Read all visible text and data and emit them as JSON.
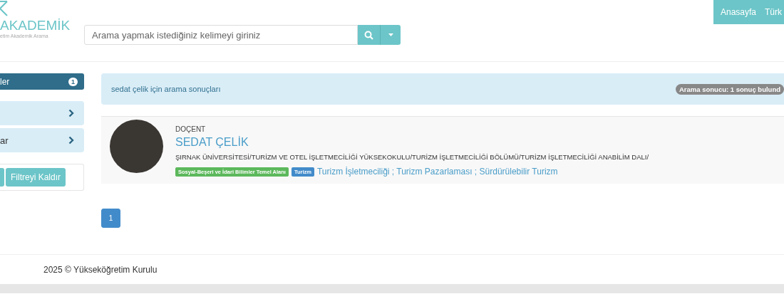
{
  "header": {
    "logo": {
      "title": "AKADEMİK",
      "subtitle": "etim Akademik Arama"
    },
    "search": {
      "placeholder": "Arama yapmak istediğiniz kelimeyi giriniz"
    },
    "nav": [
      {
        "label": "Anasayfa"
      },
      {
        "label": "Türk"
      }
    ]
  },
  "sidebar": {
    "items": [
      {
        "kind": "header",
        "label": "ler",
        "badge": "1"
      },
      {
        "kind": "panel"
      },
      {
        "kind": "panel",
        "label": "ar"
      }
    ],
    "filter_buttons": [
      {
        "label": "Filtreyi Kaldır"
      }
    ]
  },
  "alert": {
    "text": "sedat çelik için arama sonuçları",
    "badge": "Arama sonucu: 1 sonuç bulund"
  },
  "results": [
    {
      "title": "DOÇENT",
      "name": "SEDAT ÇELİK",
      "affiliation": "ŞIRNAK ÜNİVERSİTESİ/TURİZM VE OTEL İŞLETMECİLİĞİ YÜKSEKOKULU/TURİZM İŞLETMECİLİĞİ BÖLÜMÜ/TURİZM İŞLETMECİLİĞİ ANABİLİM DALI/",
      "tags": [
        {
          "label": "Sosyal-Beşeri ve İdari Bilimler Temel Alanı",
          "color": "#5cb85c"
        },
        {
          "label": "Turizm",
          "color": "#428bca"
        }
      ],
      "keywords": "Turizm İşletmeciliği ; Turizm Pazarlaması ; Sürdürülebilir Turizm"
    }
  ],
  "pagination": [
    {
      "label": "1",
      "selected": true
    }
  ],
  "footer": "2025 © Yükseköğretim Kurulu"
}
